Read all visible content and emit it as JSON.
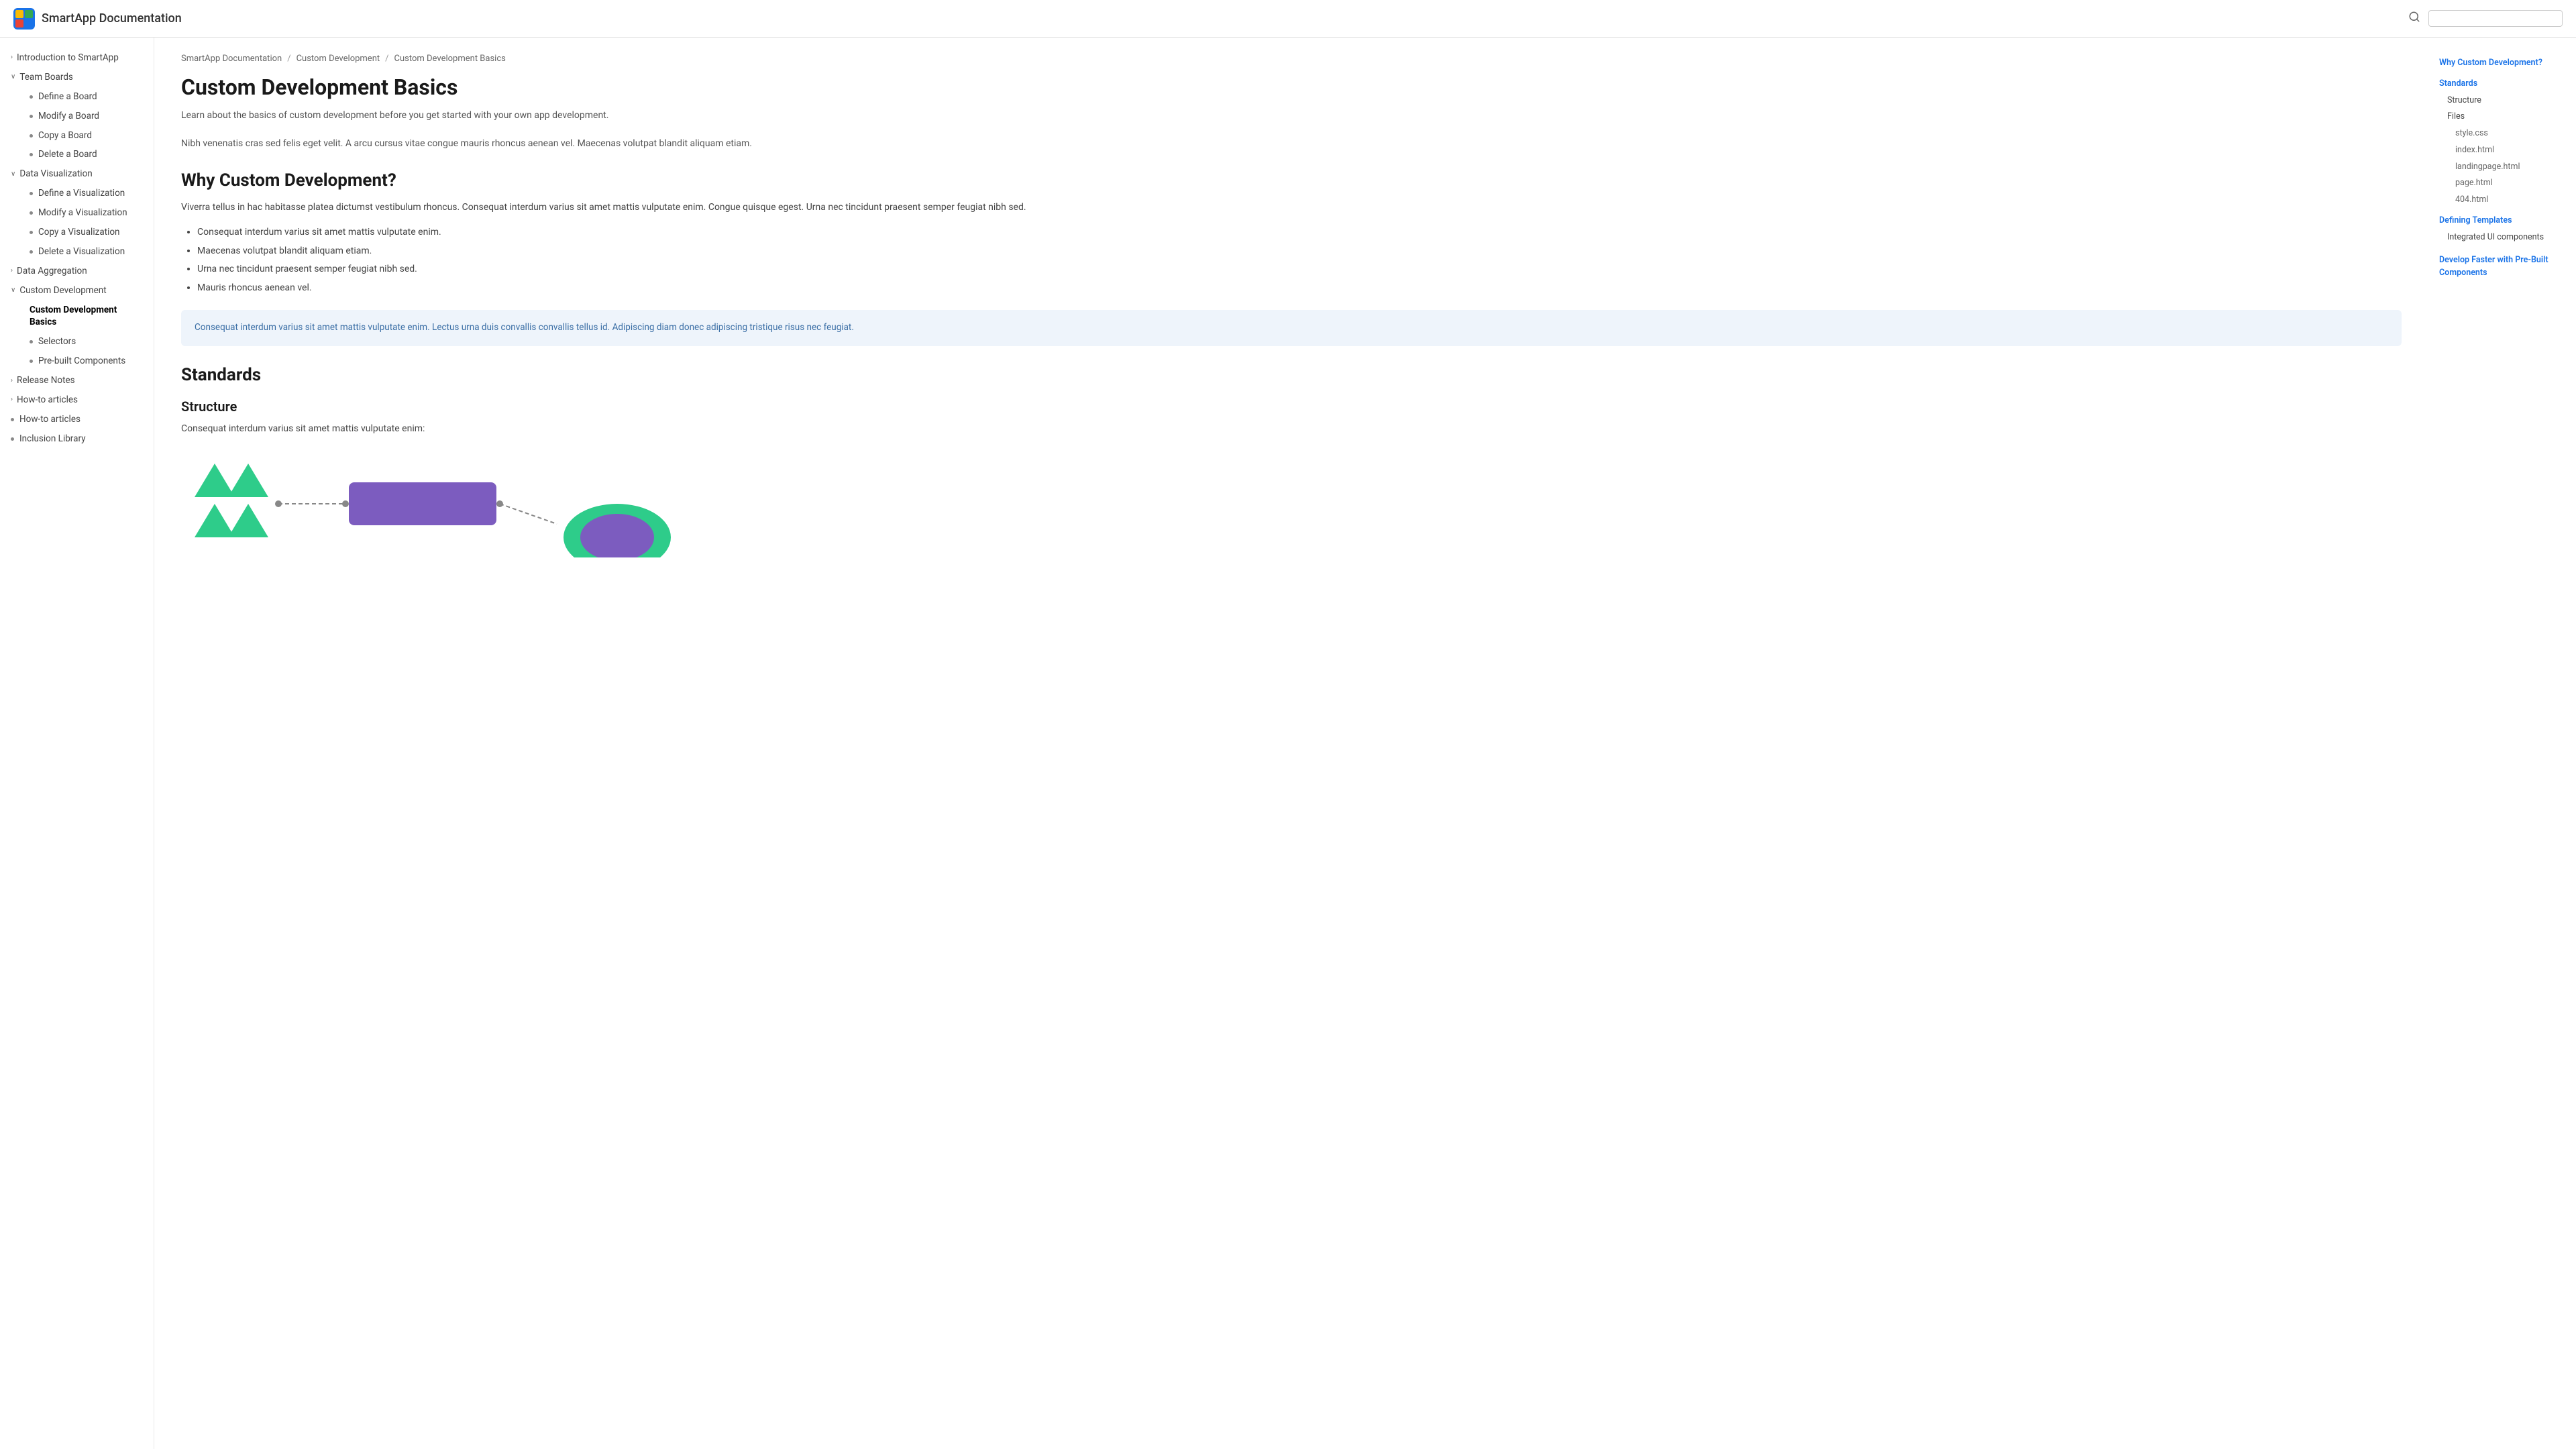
{
  "header": {
    "logo_alt": "SmartApp Logo",
    "title": "SmartApp Documentation",
    "search_placeholder": ""
  },
  "breadcrumb": {
    "items": [
      {
        "label": "SmartApp Documentation",
        "href": "#"
      },
      {
        "label": "Custom Development",
        "href": "#"
      },
      {
        "label": "Custom Development Basics",
        "href": "#"
      }
    ]
  },
  "page": {
    "title": "Custom Development Basics",
    "intro": "Learn about the basics of custom development before you get started with your own app development.",
    "intro_p2": "Nibh venenatis cras sed felis eget velit. A arcu cursus vitae congue mauris rhoncus aenean vel. Maecenas volutpat blandit aliquam etiam.",
    "section_why": {
      "heading": "Why Custom Development?",
      "body": "Viverra tellus in hac habitasse platea dictumst vestibulum rhoncus. Consequat interdum varius sit amet mattis vulputate enim. Congue quisque egest. Urna nec tincidunt praesent semper feugiat nibh sed.",
      "bullets": [
        "Consequat interdum varius sit amet mattis vulputate enim.",
        "Maecenas volutpat blandit aliquam etiam.",
        "Urna nec tincidunt praesent semper feugiat nibh sed.",
        "Mauris rhoncus aenean vel."
      ],
      "infobox": "Consequat interdum varius sit amet mattis vulputate enim. Lectus urna duis convallis convallis tellus id. Adipiscing diam donec adipiscing tristique risus nec feugiat."
    },
    "section_standards": {
      "heading": "Standards",
      "subsection_structure": {
        "heading": "Structure",
        "body": "Consequat interdum varius sit amet mattis vulputate enim:"
      }
    }
  },
  "sidebar_left": {
    "items": [
      {
        "id": "intro",
        "label": "Introduction to SmartApp",
        "type": "collapsed",
        "indent": 0
      },
      {
        "id": "team-boards",
        "label": "Team Boards",
        "type": "expanded",
        "indent": 0
      },
      {
        "id": "define-board",
        "label": "Define a Board",
        "type": "sub",
        "indent": 1
      },
      {
        "id": "modify-board",
        "label": "Modify a Board",
        "type": "sub",
        "indent": 1
      },
      {
        "id": "copy-board",
        "label": "Copy a Board",
        "type": "sub",
        "indent": 1
      },
      {
        "id": "delete-board",
        "label": "Delete a Board",
        "type": "sub",
        "indent": 1
      },
      {
        "id": "data-viz",
        "label": "Data Visualization",
        "type": "expanded",
        "indent": 0
      },
      {
        "id": "define-viz",
        "label": "Define a Visualization",
        "type": "sub",
        "indent": 1
      },
      {
        "id": "modify-viz",
        "label": "Modify a Visualization",
        "type": "sub",
        "indent": 1
      },
      {
        "id": "copy-viz",
        "label": "Copy a Visualization",
        "type": "sub",
        "indent": 1
      },
      {
        "id": "delete-viz",
        "label": "Delete a Visualization",
        "type": "sub",
        "indent": 1
      },
      {
        "id": "data-agg",
        "label": "Data Aggregation",
        "type": "collapsed",
        "indent": 0
      },
      {
        "id": "custom-dev",
        "label": "Custom Development",
        "type": "expanded",
        "indent": 0
      },
      {
        "id": "custom-dev-basics",
        "label": "Custom Development Basics",
        "type": "sub-active",
        "indent": 1
      },
      {
        "id": "selectors",
        "label": "Selectors",
        "type": "sub",
        "indent": 1
      },
      {
        "id": "prebuilt",
        "label": "Pre-built Components",
        "type": "sub",
        "indent": 1
      },
      {
        "id": "release-notes",
        "label": "Release Notes",
        "type": "collapsed",
        "indent": 0
      },
      {
        "id": "howto-articles1",
        "label": "How-to articles",
        "type": "collapsed",
        "indent": 0
      },
      {
        "id": "howto-articles2",
        "label": "How-to articles",
        "type": "sub",
        "indent": 0
      },
      {
        "id": "inclusion-lib",
        "label": "Inclusion Library",
        "type": "sub",
        "indent": 0
      }
    ]
  },
  "toc": {
    "items": [
      {
        "label": "Why Custom Development?",
        "level": "h2"
      },
      {
        "label": "Standards",
        "level": "h2"
      },
      {
        "label": "Structure",
        "level": "h3"
      },
      {
        "label": "Files",
        "level": "h3"
      },
      {
        "label": "style.css",
        "level": "h4"
      },
      {
        "label": "index.html",
        "level": "h4"
      },
      {
        "label": "landingpage.html",
        "level": "h4"
      },
      {
        "label": "page.html",
        "level": "h4"
      },
      {
        "label": "404.html",
        "level": "h4"
      },
      {
        "label": "Defining Templates",
        "level": "h2"
      },
      {
        "label": "Integrated UI components",
        "level": "h3"
      },
      {
        "label": "Develop Faster with Pre-Built Components",
        "level": "group"
      }
    ]
  },
  "icons": {
    "search": "🔍",
    "caret_right": "›",
    "caret_down": "∨",
    "dot": "•"
  }
}
